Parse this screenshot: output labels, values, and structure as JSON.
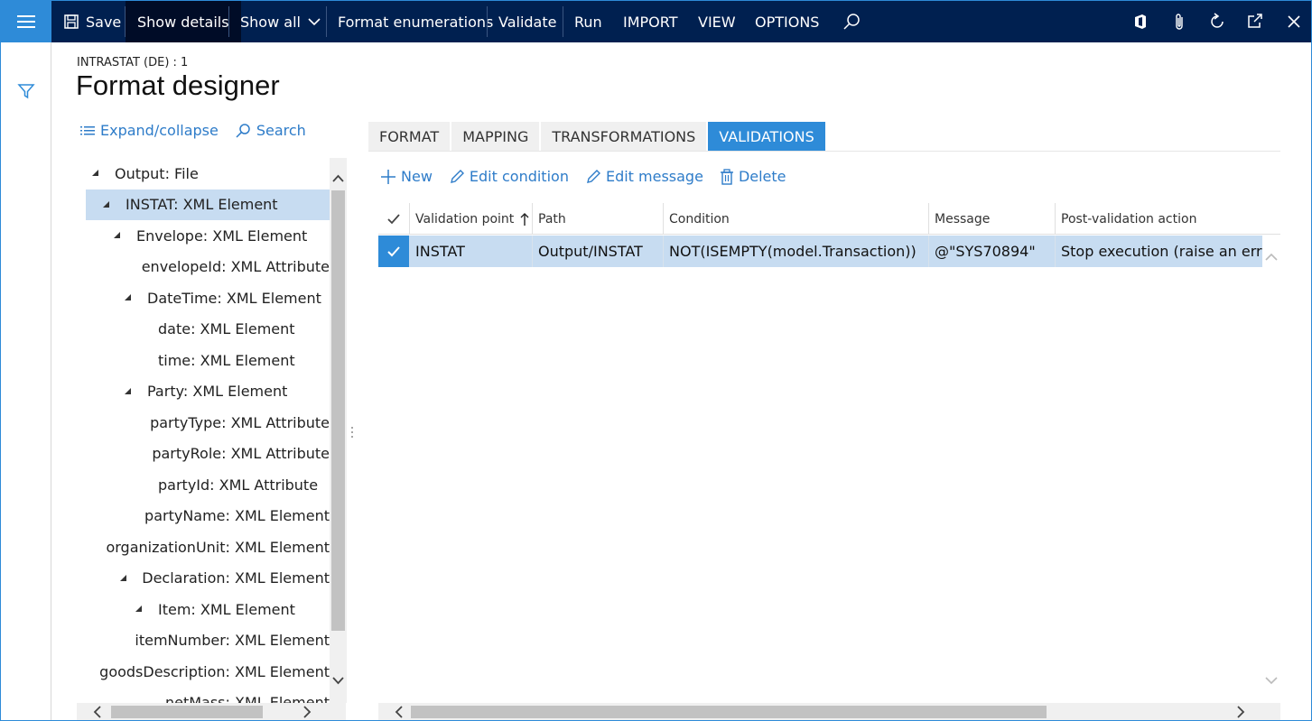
{
  "toolbar": {
    "save_label": "Save",
    "show_details_label": "Show details",
    "show_all_label": "Show all",
    "format_enumerations_label": "Format enumerations",
    "validate_label": "Validate",
    "run_label": "Run",
    "import_label": "IMPORT",
    "view_label": "VIEW",
    "options_label": "OPTIONS"
  },
  "page": {
    "breadcrumb": "INTRASTAT (DE) : 1",
    "title": "Format designer"
  },
  "tree_actions": {
    "expand_collapse": "Expand/collapse",
    "search": "Search"
  },
  "tree": [
    {
      "label": "Output: File",
      "level": 0,
      "expanded": true,
      "selected": false
    },
    {
      "label": "INSTAT: XML Element",
      "level": 1,
      "expanded": true,
      "selected": true
    },
    {
      "label": "Envelope: XML Element",
      "level": 2,
      "expanded": true,
      "selected": false
    },
    {
      "label": "envelopeId: XML Attribute",
      "level": 3,
      "expanded": null,
      "selected": false
    },
    {
      "label": "DateTime: XML Element",
      "level": 3,
      "expanded": true,
      "selected": false
    },
    {
      "label": "date: XML Element",
      "level": 4,
      "expanded": null,
      "selected": false
    },
    {
      "label": "time: XML Element",
      "level": 4,
      "expanded": null,
      "selected": false
    },
    {
      "label": "Party: XML Element",
      "level": 3,
      "expanded": true,
      "selected": false
    },
    {
      "label": "partyType: XML Attribute",
      "level": 4,
      "expanded": null,
      "selected": false
    },
    {
      "label": "partyRole: XML Attribute",
      "level": 4,
      "expanded": null,
      "selected": false
    },
    {
      "label": "partyId: XML Attribute",
      "level": 4,
      "expanded": null,
      "selected": false
    },
    {
      "label": "partyName: XML Element",
      "level": 4,
      "expanded": null,
      "selected": false
    },
    {
      "label": "organizationUnit: XML Element",
      "level": 4,
      "expanded": null,
      "selected": false
    },
    {
      "label": "Declaration: XML Element",
      "level": 3,
      "expanded": true,
      "selected": false
    },
    {
      "label": "Item: XML Element",
      "level": 4,
      "expanded": true,
      "selected": false
    },
    {
      "label": "itemNumber: XML Element",
      "level": 5,
      "expanded": null,
      "selected": false
    },
    {
      "label": "goodsDescription: XML Element",
      "level": 5,
      "expanded": null,
      "selected": false
    },
    {
      "label": "netMass: XML Element",
      "level": 5,
      "expanded": null,
      "selected": false
    }
  ],
  "tabs": [
    "FORMAT",
    "MAPPING",
    "TRANSFORMATIONS",
    "VALIDATIONS"
  ],
  "active_tab": "VALIDATIONS",
  "grid_actions": {
    "new": "New",
    "edit_condition": "Edit condition",
    "edit_message": "Edit message",
    "delete": "Delete"
  },
  "grid": {
    "columns": [
      "Validation point",
      "Path",
      "Condition",
      "Message",
      "Post-validation action"
    ],
    "rows": [
      {
        "validation_point": "INSTAT",
        "path": "Output/INSTAT",
        "condition": "NOT(ISEMPTY(model.Transaction))",
        "message": "@\"SYS70894\"",
        "post_action": "Stop execution (raise an error)",
        "selected": true
      }
    ]
  },
  "colors": {
    "navbar": "#002050",
    "accent": "#2e8bd8",
    "selection": "#c7dcf1",
    "link": "#2e7cc9"
  }
}
